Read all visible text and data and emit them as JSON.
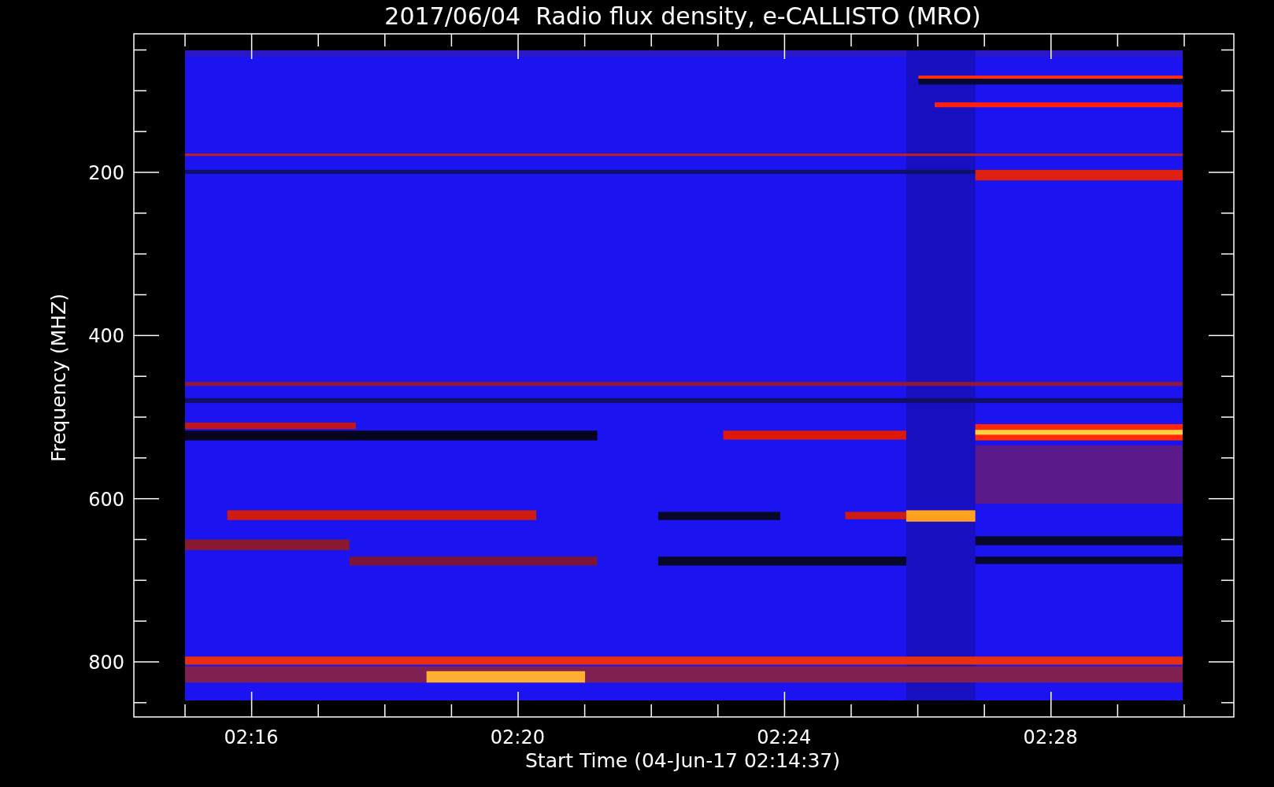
{
  "title": "2017/06/04  Radio flux density, e-CALLISTO (MRO)",
  "xlabel": "Start Time (04-Jun-17 02:14:37)",
  "ylabel": "Frequency (MHZ)",
  "xticks": [
    "02:16",
    "02:20",
    "02:24",
    "02:28"
  ],
  "yticks": [
    "200",
    "400",
    "600",
    "800"
  ]
}
